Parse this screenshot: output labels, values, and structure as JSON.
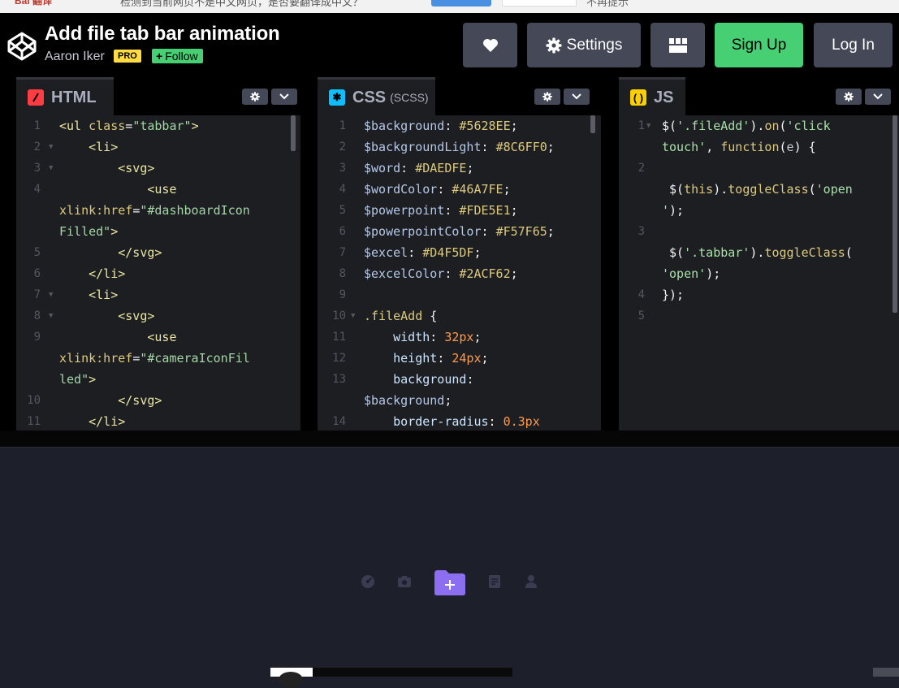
{
  "strip": {
    "left": "Bai 翻译",
    "middle": "检测到当前网页不是中文网页，是否要翻译成中文？",
    "right": "不再提示"
  },
  "header": {
    "title": "Add file tab bar animation",
    "author": "Aaron Iker",
    "pro_badge": "PRO",
    "follow_label": "Follow",
    "settings_label": "Settings",
    "signup_label": "Sign Up",
    "login_label": "Log In"
  },
  "panels": {
    "html": {
      "label": "HTML",
      "sub": "",
      "accent": "#ff3c41"
    },
    "css": {
      "label": "CSS",
      "sub": "(SCSS)",
      "accent": "#0ebeff"
    },
    "js": {
      "label": "JS",
      "sub": "",
      "accent": "#fcd000"
    }
  },
  "html_code": {
    "line_numbers": [
      "1",
      "2",
      "3",
      "4",
      "",
      "5",
      "6",
      "7",
      "8",
      "9",
      "",
      "10",
      "11"
    ],
    "lines": [
      [
        "t-tag",
        "<ul "
      ],
      [
        "t-tag",
        "    <li>"
      ],
      [
        "t-tag",
        "        <svg>"
      ],
      [
        "t-tag",
        "            <use"
      ],
      [
        "t-attr",
        "xlink:href"
      ],
      [
        "t-attr",
        "Filled\">"
      ],
      [
        "t-tag",
        "        </svg>"
      ],
      [
        "t-tag",
        "    </li>"
      ],
      [
        "t-tag",
        "    <li>"
      ],
      [
        "t-tag",
        "        <svg>"
      ],
      [
        "t-tag",
        "            <use"
      ],
      [
        "t-attr",
        "xlink:href"
      ],
      [
        "t-attr",
        "led\">"
      ]
    ]
  },
  "css_code": {
    "line_numbers": [
      "1",
      "2",
      "3",
      "4",
      "5",
      "6",
      "7",
      "8",
      "9",
      "10",
      "11",
      "12",
      "13",
      "",
      "14"
    ]
  },
  "js_code": {
    "line_numbers": [
      "1",
      "",
      "2",
      "",
      "3",
      "",
      "4",
      "5"
    ]
  },
  "colors": {
    "signup": "#47cf73",
    "button": "#444857",
    "preview_bg": "#1d1f2a",
    "add_button": "#8c6ff0"
  }
}
